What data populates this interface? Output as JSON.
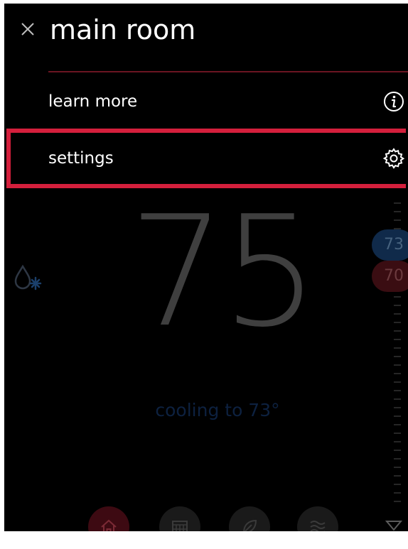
{
  "menu": {
    "title": "main room",
    "items": [
      {
        "label": "learn more",
        "icon": "info-icon"
      },
      {
        "label": "settings",
        "icon": "gear-icon"
      }
    ],
    "highlighted_item": "settings"
  },
  "thermostat": {
    "current_temp": "75",
    "status": "cooling to 73°",
    "cool_setpoint": "73",
    "heat_setpoint": "70",
    "mode_icon": "water-drop-snowflake-icon"
  },
  "bottom_nav": [
    {
      "name": "home",
      "icon": "home-icon",
      "active": true
    },
    {
      "name": "schedule",
      "icon": "calendar-icon",
      "active": false
    },
    {
      "name": "eco",
      "icon": "leaf-icon",
      "active": false
    },
    {
      "name": "air",
      "icon": "wave-icon",
      "active": false
    }
  ],
  "colors": {
    "accent_red": "#d41f3c",
    "cool_blue": "#1e4f8c",
    "heat_red": "#7a1a22"
  }
}
